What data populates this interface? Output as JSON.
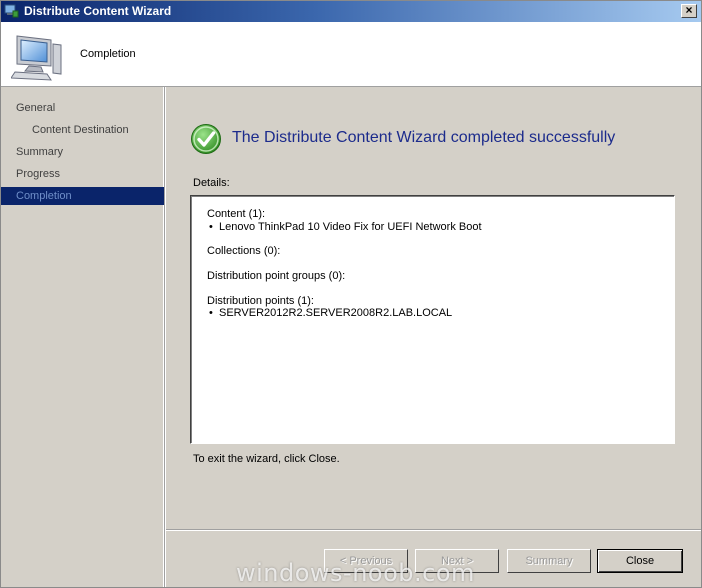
{
  "window": {
    "title": "Distribute Content Wizard",
    "close_glyph": "×"
  },
  "header": {
    "title": "Completion",
    "icon": "computer-icon"
  },
  "sidebar": {
    "items": [
      {
        "label": "General",
        "sub": false,
        "active": false
      },
      {
        "label": "Content Destination",
        "sub": true,
        "active": false
      },
      {
        "label": "Summary",
        "sub": false,
        "active": false
      },
      {
        "label": "Progress",
        "sub": false,
        "active": false
      },
      {
        "label": "Completion",
        "sub": false,
        "active": true
      }
    ]
  },
  "main": {
    "success_title": "The Distribute Content Wizard completed successfully",
    "details_label": "Details:",
    "details": {
      "content_heading": "Content (1):",
      "content_items": [
        "Lenovo ThinkPad 10 Video Fix for UEFI Network Boot"
      ],
      "collections_heading": "Collections (0):",
      "dp_groups_heading": "Distribution point groups (0):",
      "dp_heading": "Distribution points (1):",
      "dp_items": [
        "SERVER2012R2.SERVER2008R2.LAB.LOCAL"
      ]
    },
    "exit_text": "To exit the wizard, click Close."
  },
  "buttons": {
    "previous": "< Previous",
    "next": "Next >",
    "summary": "Summary",
    "close": "Close"
  },
  "watermark": "windows-noob.com",
  "colors": {
    "title_text": "#1c2b8c",
    "active_nav_bg": "#0a246a",
    "success_green": "#3aa02a"
  }
}
